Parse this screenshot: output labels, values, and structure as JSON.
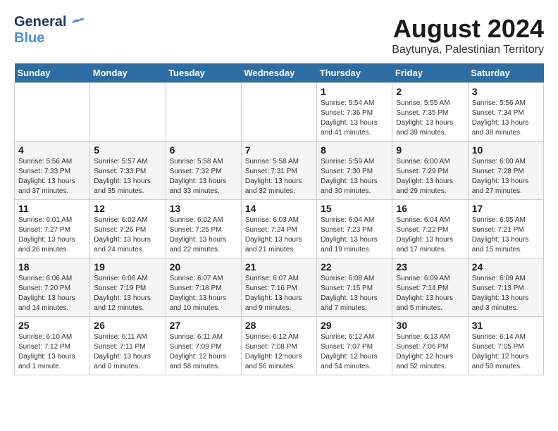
{
  "header": {
    "logo_general": "General",
    "logo_blue": "Blue",
    "main_title": "August 2024",
    "subtitle": "Baytunya, Palestinian Territory"
  },
  "weekdays": [
    "Sunday",
    "Monday",
    "Tuesday",
    "Wednesday",
    "Thursday",
    "Friday",
    "Saturday"
  ],
  "weeks": [
    [
      {
        "day": "",
        "info": ""
      },
      {
        "day": "",
        "info": ""
      },
      {
        "day": "",
        "info": ""
      },
      {
        "day": "",
        "info": ""
      },
      {
        "day": "1",
        "info": "Sunrise: 5:54 AM\nSunset: 7:36 PM\nDaylight: 13 hours\nand 41 minutes."
      },
      {
        "day": "2",
        "info": "Sunrise: 5:55 AM\nSunset: 7:35 PM\nDaylight: 13 hours\nand 39 minutes."
      },
      {
        "day": "3",
        "info": "Sunrise: 5:56 AM\nSunset: 7:34 PM\nDaylight: 13 hours\nand 38 minutes."
      }
    ],
    [
      {
        "day": "4",
        "info": "Sunrise: 5:56 AM\nSunset: 7:33 PM\nDaylight: 13 hours\nand 37 minutes."
      },
      {
        "day": "5",
        "info": "Sunrise: 5:57 AM\nSunset: 7:33 PM\nDaylight: 13 hours\nand 35 minutes."
      },
      {
        "day": "6",
        "info": "Sunrise: 5:58 AM\nSunset: 7:32 PM\nDaylight: 13 hours\nand 33 minutes."
      },
      {
        "day": "7",
        "info": "Sunrise: 5:58 AM\nSunset: 7:31 PM\nDaylight: 13 hours\nand 32 minutes."
      },
      {
        "day": "8",
        "info": "Sunrise: 5:59 AM\nSunset: 7:30 PM\nDaylight: 13 hours\nand 30 minutes."
      },
      {
        "day": "9",
        "info": "Sunrise: 6:00 AM\nSunset: 7:29 PM\nDaylight: 13 hours\nand 29 minutes."
      },
      {
        "day": "10",
        "info": "Sunrise: 6:00 AM\nSunset: 7:28 PM\nDaylight: 13 hours\nand 27 minutes."
      }
    ],
    [
      {
        "day": "11",
        "info": "Sunrise: 6:01 AM\nSunset: 7:27 PM\nDaylight: 13 hours\nand 26 minutes."
      },
      {
        "day": "12",
        "info": "Sunrise: 6:02 AM\nSunset: 7:26 PM\nDaylight: 13 hours\nand 24 minutes."
      },
      {
        "day": "13",
        "info": "Sunrise: 6:02 AM\nSunset: 7:25 PM\nDaylight: 13 hours\nand 22 minutes."
      },
      {
        "day": "14",
        "info": "Sunrise: 6:03 AM\nSunset: 7:24 PM\nDaylight: 13 hours\nand 21 minutes."
      },
      {
        "day": "15",
        "info": "Sunrise: 6:04 AM\nSunset: 7:23 PM\nDaylight: 13 hours\nand 19 minutes."
      },
      {
        "day": "16",
        "info": "Sunrise: 6:04 AM\nSunset: 7:22 PM\nDaylight: 13 hours\nand 17 minutes."
      },
      {
        "day": "17",
        "info": "Sunrise: 6:05 AM\nSunset: 7:21 PM\nDaylight: 13 hours\nand 15 minutes."
      }
    ],
    [
      {
        "day": "18",
        "info": "Sunrise: 6:06 AM\nSunset: 7:20 PM\nDaylight: 13 hours\nand 14 minutes."
      },
      {
        "day": "19",
        "info": "Sunrise: 6:06 AM\nSunset: 7:19 PM\nDaylight: 13 hours\nand 12 minutes."
      },
      {
        "day": "20",
        "info": "Sunrise: 6:07 AM\nSunset: 7:18 PM\nDaylight: 13 hours\nand 10 minutes."
      },
      {
        "day": "21",
        "info": "Sunrise: 6:07 AM\nSunset: 7:16 PM\nDaylight: 13 hours\nand 9 minutes."
      },
      {
        "day": "22",
        "info": "Sunrise: 6:08 AM\nSunset: 7:15 PM\nDaylight: 13 hours\nand 7 minutes."
      },
      {
        "day": "23",
        "info": "Sunrise: 6:09 AM\nSunset: 7:14 PM\nDaylight: 13 hours\nand 5 minutes."
      },
      {
        "day": "24",
        "info": "Sunrise: 6:09 AM\nSunset: 7:13 PM\nDaylight: 13 hours\nand 3 minutes."
      }
    ],
    [
      {
        "day": "25",
        "info": "Sunrise: 6:10 AM\nSunset: 7:12 PM\nDaylight: 13 hours\nand 1 minute."
      },
      {
        "day": "26",
        "info": "Sunrise: 6:11 AM\nSunset: 7:11 PM\nDaylight: 13 hours\nand 0 minutes."
      },
      {
        "day": "27",
        "info": "Sunrise: 6:11 AM\nSunset: 7:09 PM\nDaylight: 12 hours\nand 58 minutes."
      },
      {
        "day": "28",
        "info": "Sunrise: 6:12 AM\nSunset: 7:08 PM\nDaylight: 12 hours\nand 56 minutes."
      },
      {
        "day": "29",
        "info": "Sunrise: 6:12 AM\nSunset: 7:07 PM\nDaylight: 12 hours\nand 54 minutes."
      },
      {
        "day": "30",
        "info": "Sunrise: 6:13 AM\nSunset: 7:06 PM\nDaylight: 12 hours\nand 52 minutes."
      },
      {
        "day": "31",
        "info": "Sunrise: 6:14 AM\nSunset: 7:05 PM\nDaylight: 12 hours\nand 50 minutes."
      }
    ]
  ]
}
